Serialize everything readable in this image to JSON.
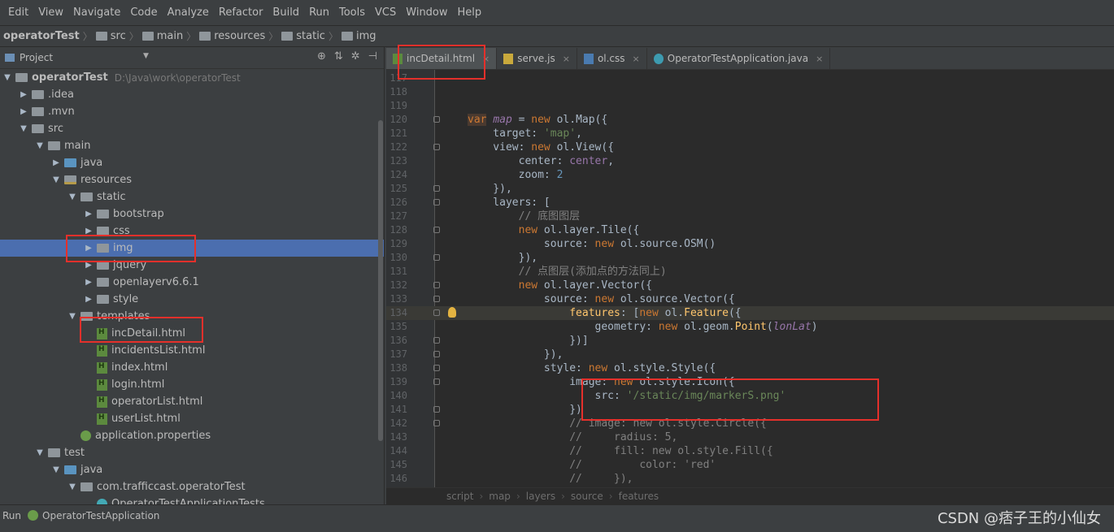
{
  "menu": [
    "Edit",
    "View",
    "Navigate",
    "Code",
    "Analyze",
    "Refactor",
    "Build",
    "Run",
    "Tools",
    "VCS",
    "Window",
    "Help"
  ],
  "breadcrumb": [
    "operatorTest",
    "src",
    "main",
    "resources",
    "static",
    "img"
  ],
  "project_panel": {
    "title": "Project",
    "tree": [
      {
        "label": "operatorTest",
        "extra": "D:\\Java\\work\\operatorTest",
        "depth": 0,
        "arrow": "down",
        "icon": "folder-grey",
        "bold": true
      },
      {
        "label": ".idea",
        "depth": 1,
        "arrow": "right",
        "icon": "folder-grey"
      },
      {
        "label": ".mvn",
        "depth": 1,
        "arrow": "right",
        "icon": "folder-grey"
      },
      {
        "label": "src",
        "depth": 1,
        "arrow": "down",
        "icon": "folder-grey"
      },
      {
        "label": "main",
        "depth": 2,
        "arrow": "down",
        "icon": "folder-grey"
      },
      {
        "label": "java",
        "depth": 3,
        "arrow": "right",
        "icon": "folder-blue"
      },
      {
        "label": "resources",
        "depth": 3,
        "arrow": "down",
        "icon": "folder-res"
      },
      {
        "label": "static",
        "depth": 4,
        "arrow": "down",
        "icon": "folder-grey"
      },
      {
        "label": "bootstrap",
        "depth": 5,
        "arrow": "right",
        "icon": "folder-grey"
      },
      {
        "label": "css",
        "depth": 5,
        "arrow": "right",
        "icon": "folder-grey"
      },
      {
        "label": "img",
        "depth": 5,
        "arrow": "right",
        "icon": "folder-grey",
        "selected": true
      },
      {
        "label": "jquery",
        "depth": 5,
        "arrow": "right",
        "icon": "folder-grey"
      },
      {
        "label": "openlayerv6.6.1",
        "depth": 5,
        "arrow": "right",
        "icon": "folder-grey"
      },
      {
        "label": "style",
        "depth": 5,
        "arrow": "right",
        "icon": "folder-grey"
      },
      {
        "label": "templates",
        "depth": 4,
        "arrow": "down",
        "icon": "folder-grey"
      },
      {
        "label": "incDetail.html",
        "depth": 5,
        "arrow": "",
        "icon": "html"
      },
      {
        "label": "incidentsList.html",
        "depth": 5,
        "arrow": "",
        "icon": "html"
      },
      {
        "label": "index.html",
        "depth": 5,
        "arrow": "",
        "icon": "html"
      },
      {
        "label": "login.html",
        "depth": 5,
        "arrow": "",
        "icon": "html"
      },
      {
        "label": "operatorList.html",
        "depth": 5,
        "arrow": "",
        "icon": "html"
      },
      {
        "label": "userList.html",
        "depth": 5,
        "arrow": "",
        "icon": "html"
      },
      {
        "label": "application.properties",
        "depth": 4,
        "arrow": "",
        "icon": "properties"
      },
      {
        "label": "test",
        "depth": 2,
        "arrow": "down",
        "icon": "folder-grey"
      },
      {
        "label": "java",
        "depth": 3,
        "arrow": "down",
        "icon": "folder-blue"
      },
      {
        "label": "com.trafficcast.operatorTest",
        "depth": 4,
        "arrow": "down",
        "icon": "package"
      },
      {
        "label": "OperatorTestApplicationTests",
        "depth": 5,
        "arrow": "",
        "icon": "java"
      }
    ]
  },
  "tabs": [
    {
      "label": "incDetail.html",
      "icon": "html",
      "active": true
    },
    {
      "label": "serve.js",
      "icon": "js"
    },
    {
      "label": "ol.css",
      "icon": "css"
    },
    {
      "label": "OperatorTestApplication.java",
      "icon": "java"
    }
  ],
  "code_lines": [
    {
      "n": "117",
      "html": ""
    },
    {
      "n": "118",
      "html": ""
    },
    {
      "n": "119",
      "html": ""
    },
    {
      "n": "120",
      "html": "<span class='kw' style='background:#4a3a30'>var</span> <span class='var'>map</span> = <span class='kw'>new</span> ol.Map({"
    },
    {
      "n": "121",
      "html": "    target: <span class='str'>'map'</span>,"
    },
    {
      "n": "122",
      "html": "    view: <span class='kw'>new</span> ol.View({"
    },
    {
      "n": "123",
      "html": "        center: <span class='fld'>center</span>,"
    },
    {
      "n": "124",
      "html": "        zoom: <span class='num'>2</span>"
    },
    {
      "n": "125",
      "html": "    }),"
    },
    {
      "n": "126",
      "html": "    layers: ["
    },
    {
      "n": "127",
      "html": "        <span class='cm'>// 底图图层</span>"
    },
    {
      "n": "128",
      "html": "        <span class='kw'>new</span> ol.layer.Tile({"
    },
    {
      "n": "129",
      "html": "            source: <span class='kw'>new</span> ol.source.OSM()"
    },
    {
      "n": "130",
      "html": "        }),"
    },
    {
      "n": "131",
      "html": "        <span class='cm'>// 点图层(添加点的方法同上)</span>"
    },
    {
      "n": "132",
      "html": "        <span class='kw'>new</span> ol.layer.Vector({"
    },
    {
      "n": "133",
      "html": "            source: <span class='kw'>new</span> ol.source.Vector({"
    },
    {
      "n": "134",
      "html": "                <span class='prop'>features</span>: [<span class='kw'>new</span> ol.<span class='prop'>Feature</span>({",
      "hl": true,
      "bulb": true
    },
    {
      "n": "135",
      "html": "                    geometry: <span class='kw'>new</span> ol.geom.<span class='prop'>Point</span>(<span class='var'>lonLat</span>)"
    },
    {
      "n": "136",
      "html": "                })]"
    },
    {
      "n": "137",
      "html": "            }),"
    },
    {
      "n": "138",
      "html": "            style: <span class='kw'>new</span> ol.style.Style({"
    },
    {
      "n": "139",
      "html": "                image: <span class='kw'>new</span> ol.style.Icon({"
    },
    {
      "n": "140",
      "html": "                    src: <span class='str'>'/static/img/markerS.png'</span>"
    },
    {
      "n": "141",
      "html": "                })"
    },
    {
      "n": "142",
      "html": "                <span class='cm'>// image: new ol.style.Circle({</span>"
    },
    {
      "n": "143",
      "html": "                <span class='cm'>//     radius: 5,</span>"
    },
    {
      "n": "144",
      "html": "                <span class='cm'>//     fill: new ol.style.Fill({</span>"
    },
    {
      "n": "145",
      "html": "                <span class='cm'>//         color: 'red'</span>"
    },
    {
      "n": "146",
      "html": "                <span class='cm'>//     }),</span>"
    }
  ],
  "editor_breadcrumb": [
    "script",
    "map",
    "layers",
    "source",
    "features"
  ],
  "run_bar": {
    "label": "Run",
    "config": "OperatorTestApplication"
  },
  "watermark": "CSDN @痞子王的小仙女",
  "colors": {
    "annotation_red": "#e5302b",
    "selection_blue": "#4b6eaf"
  }
}
